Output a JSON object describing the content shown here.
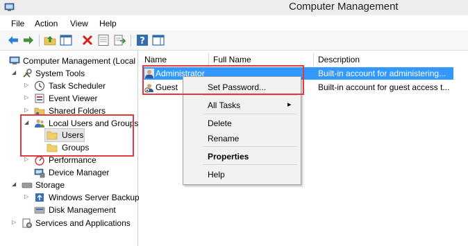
{
  "window": {
    "title": "Computer Management"
  },
  "menu": [
    "File",
    "Action",
    "View",
    "Help"
  ],
  "toolbar": {
    "icons": [
      "back-arrow-icon",
      "forward-arrow-icon",
      "up-folder-icon",
      "show-hide-tree-icon",
      "delete-icon",
      "properties-icon",
      "export-list-icon",
      "help-icon",
      "show-hide-action-pane-icon"
    ]
  },
  "tree": {
    "root": "Computer Management (Local",
    "system_tools": "System Tools",
    "task_scheduler": "Task Scheduler",
    "event_viewer": "Event Viewer",
    "shared_folders": "Shared Folders",
    "local_users_groups": "Local Users and Groups",
    "users": "Users",
    "groups": "Groups",
    "performance": "Performance",
    "device_manager": "Device Manager",
    "storage": "Storage",
    "windows_server_backup": "Windows Server Backup",
    "disk_management": "Disk Management",
    "services_apps": "Services and Applications"
  },
  "list": {
    "columns": [
      "Name",
      "Full Name",
      "Description"
    ],
    "rows": [
      {
        "name": "Administrator",
        "full_name": "",
        "description": "Built-in account for administering..."
      },
      {
        "name": "Guest",
        "full_name": "",
        "description": "Built-in account for guest access t..."
      }
    ]
  },
  "context_menu": {
    "set_password": "Set Password...",
    "all_tasks": "All Tasks",
    "all_tasks_arrow": "▸",
    "delete": "Delete",
    "rename": "Rename",
    "properties": "Properties",
    "help": "Help"
  },
  "colors": {
    "selection": "#3399ff",
    "highlight_box": "#e0393e"
  }
}
